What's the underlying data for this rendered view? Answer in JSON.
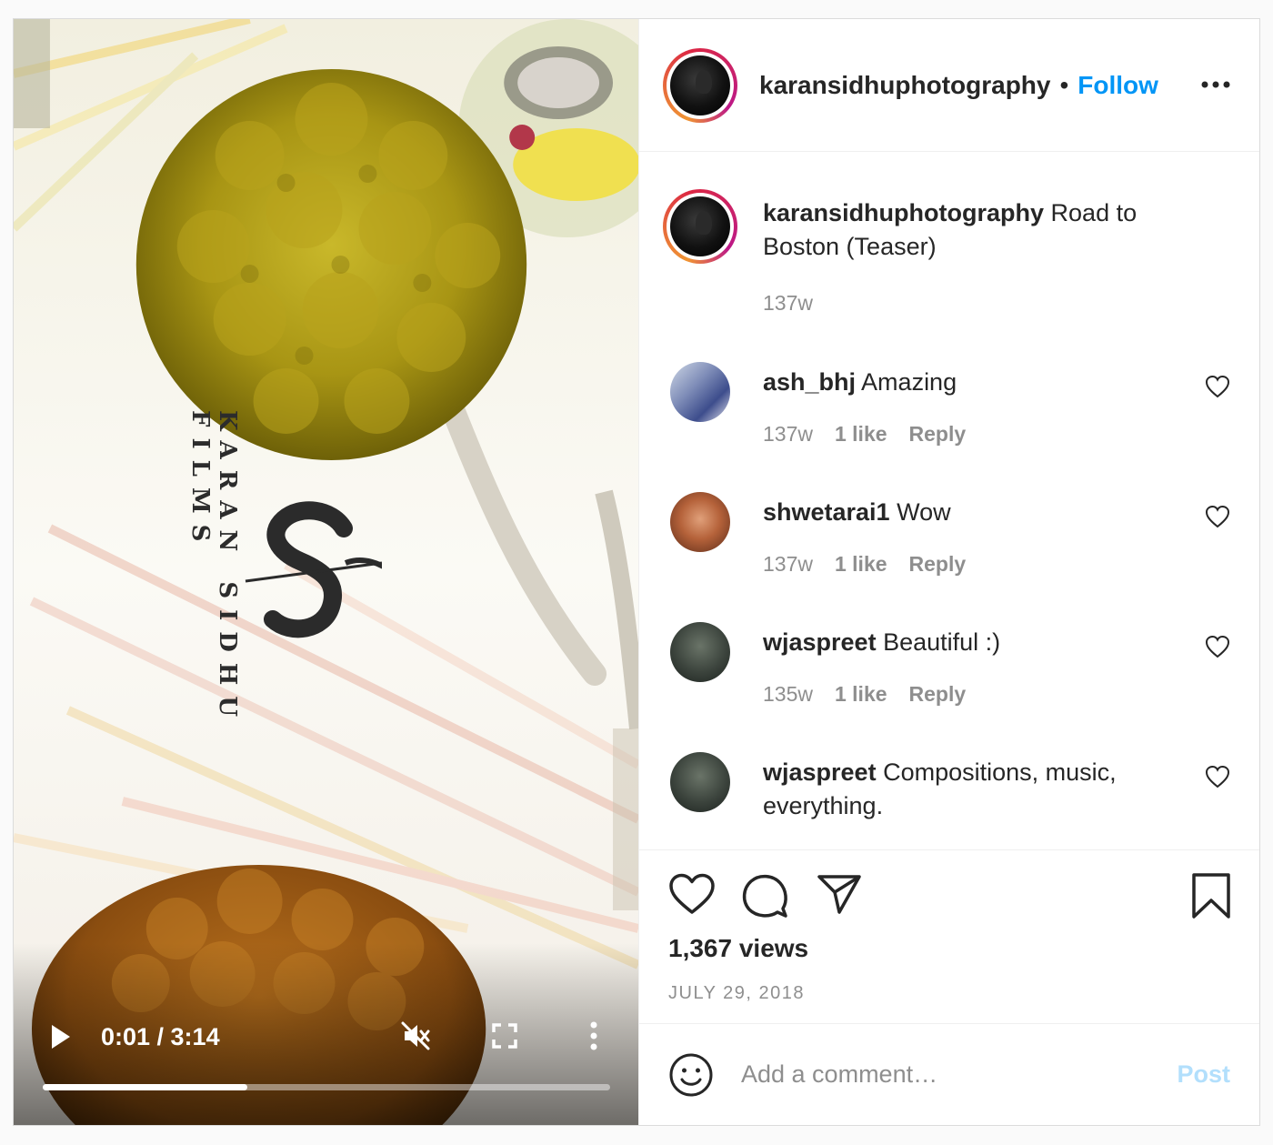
{
  "video": {
    "brand_text": "KARAN SIDHU FILMS",
    "current_time": "0:01 / 3:14",
    "progress_fraction": 0.36,
    "icons": {
      "play": "play-icon",
      "mute": "muted-speaker-icon",
      "fullscreen": "fullscreen-icon",
      "more": "vertical-dots-icon"
    }
  },
  "header": {
    "username": "karansidhuphotography",
    "separator": "•",
    "follow_label": "Follow",
    "more_icon": "horizontal-dots-icon"
  },
  "caption": {
    "username": "karansidhuphotography",
    "text": "Road to Boston (Teaser)",
    "time": "137w"
  },
  "comments": [
    {
      "username": "ash_bhj",
      "text": "Amazing",
      "time": "137w",
      "likes": "1 like",
      "reply_label": "Reply"
    },
    {
      "username": "shwetarai1",
      "text": "Wow",
      "time": "137w",
      "likes": "1 like",
      "reply_label": "Reply"
    },
    {
      "username": "wjaspreet",
      "text": "Beautiful :)",
      "time": "135w",
      "likes": "1 like",
      "reply_label": "Reply"
    },
    {
      "username": "wjaspreet",
      "text": "Compositions, music, everything."
    }
  ],
  "actions": {
    "views": "1,367 views",
    "date": "JULY 29, 2018"
  },
  "add_comment": {
    "placeholder": "Add a comment…",
    "post_label": "Post"
  },
  "colors": {
    "link_blue": "#0095f6",
    "post_disabled": "#b2dffc",
    "secondary_text": "#8e8e8e"
  }
}
